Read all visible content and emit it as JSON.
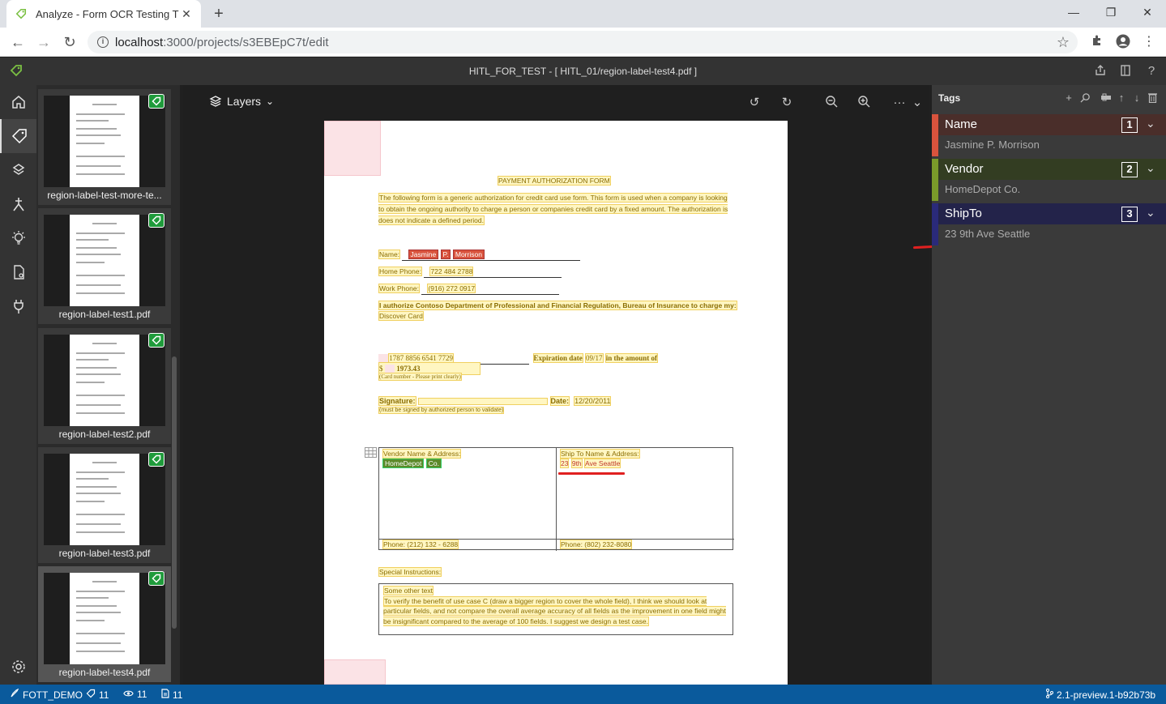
{
  "browser": {
    "tab_title": "Analyze - Form OCR Testing T",
    "url_host": "localhost",
    "url_path": ":3000/projects/s3EBEpC7t/edit"
  },
  "app": {
    "title": "HITL_FOR_TEST - [ HITL_01/region-label-test4.pdf ]"
  },
  "thumbnails": [
    {
      "label": "region-label-test-more-te..."
    },
    {
      "label": "region-label-test1.pdf"
    },
    {
      "label": "region-label-test2.pdf"
    },
    {
      "label": "region-label-test3.pdf"
    },
    {
      "label": "region-label-test4.pdf"
    }
  ],
  "canvas": {
    "layers_label": "Layers"
  },
  "document": {
    "heading": "PAYMENT AUTHORIZATION FORM",
    "intro": "The following form is a generic authorization for credit card use form. This form is used when a company is looking to obtain the ongoing authority to charge a person or companies credit card by a fixed amount. The authorization is does not indicate a defined period.",
    "name_label": "Name:",
    "name_first": "Jasmine",
    "name_mid": "P.",
    "name_last": "Morrison",
    "home_phone_label": "Home Phone:",
    "home_phone": "722 484 2788",
    "work_phone_label": "Work Phone:",
    "work_phone": "(916) 272 0917",
    "authorize": "I authorize Contoso Department of Professional and Financial Regulation, Bureau of Insurance to charge my:",
    "card_type": "Discover Card",
    "card_number": "1787 8856 6541 7729",
    "expiration_label": "Expiration date",
    "expiration": "09/17",
    "amount_label": "in the amount of",
    "amount_symbol": "$",
    "amount": "1973.43",
    "card_note": "(Card number - Please print clearly)",
    "signature_label": "Signature:",
    "date_label": "Date:",
    "date": "12/20/2011",
    "signature_note": "(must be signed by authorized person to validate)",
    "vendor_label": "Vendor Name & Address:",
    "vendor_name": "HomeDepot",
    "vendor_co": "Co.",
    "shipto_label": "Ship To Name & Address:",
    "ship_num": "23",
    "ship_9th": "9th",
    "ship_rest": "Ave Seattle",
    "vendor_phone": "Phone: (212) 132 - 6288",
    "ship_phone": "Phone: (802) 232-8080",
    "special_label": "Special Instructions:",
    "special_line1": "Some other text",
    "special_body": "To verify the benefit of use case C (draw a bigger region to cover the whole field), I think we should look at particular fields, and not compare the overall average accuracy of all fields as the improvement in one field might be insignificant compared to the average of 100 fields. I suggest we design a test case."
  },
  "tags_panel": {
    "title": "Tags",
    "tags": [
      {
        "name": "Name",
        "hotkey": "1",
        "value": "Jasmine P. Morrison",
        "color": "#d9533d",
        "bg": "#4a2e2a"
      },
      {
        "name": "Vendor",
        "hotkey": "2",
        "value": "HomeDepot Co.",
        "color": "#7a9a2a",
        "bg": "#333d22"
      },
      {
        "name": "ShipTo",
        "hotkey": "3",
        "value": "23 9th Ave Seattle",
        "color": "#2a2a7a",
        "bg": "#23234a"
      }
    ]
  },
  "status": {
    "project": "FOTT_DEMO",
    "tag_count": "11",
    "visited_count": "11",
    "asset_count": "11",
    "version": "2.1-preview.1-b92b73b"
  }
}
